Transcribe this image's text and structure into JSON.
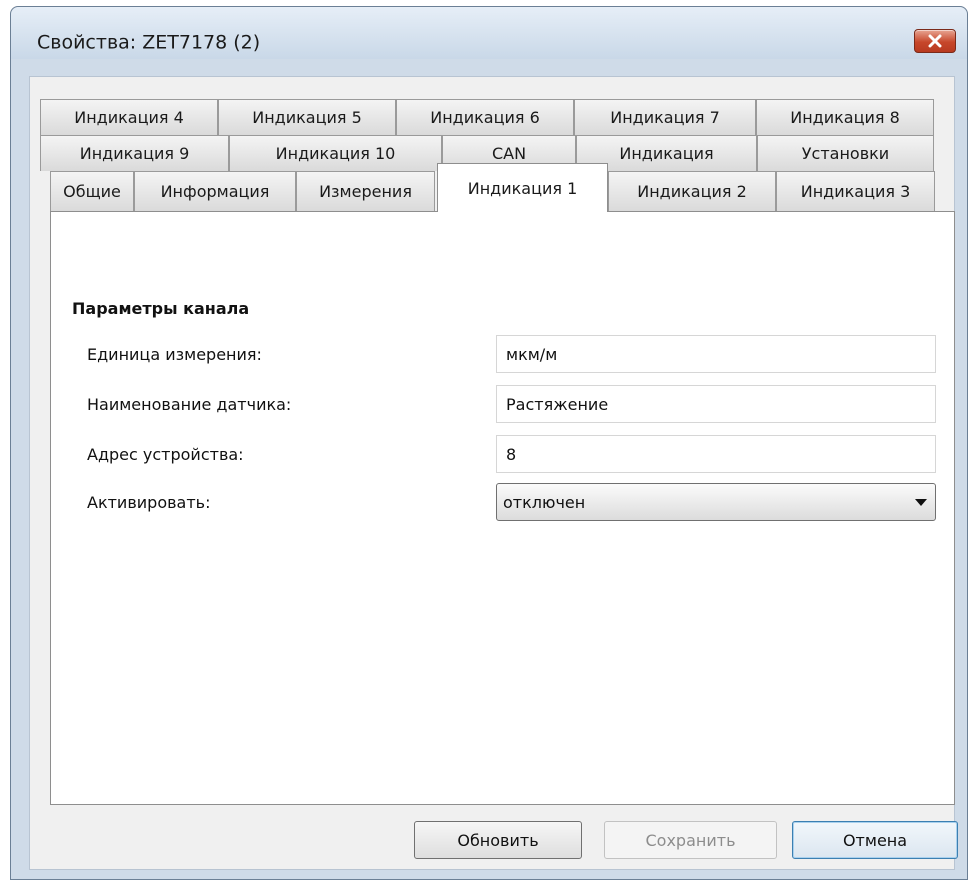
{
  "window": {
    "title": "Свойства: ZET7178 (2)"
  },
  "tabs": {
    "row1": [
      "Индикация 4",
      "Индикация 5",
      "Индикация 6",
      "Индикация 7",
      "Индикация 8"
    ],
    "row2": [
      "Индикация 9",
      "Индикация 10",
      "CAN",
      "Индикация",
      "Установки"
    ],
    "row3": [
      "Общие",
      "Информация",
      "Измерения",
      "Индикация 1",
      "Индикация 2",
      "Индикация 3"
    ],
    "active": "Индикация 1"
  },
  "panel": {
    "group_title": "Параметры канала",
    "fields": [
      {
        "label": "Единица измерения:",
        "value": "мкм/м"
      },
      {
        "label": "Наименование датчика:",
        "value": "Растяжение"
      },
      {
        "label": "Адрес устройства:",
        "value": "8"
      },
      {
        "label": "Активировать:",
        "value": "отключен"
      }
    ]
  },
  "buttons": {
    "refresh": "Обновить",
    "save": "Сохранить",
    "cancel": "Отмена"
  },
  "colors": {
    "frame": "#cfdbe8",
    "close_button": "#c7472b",
    "default_button_border": "#3c7fb1"
  }
}
